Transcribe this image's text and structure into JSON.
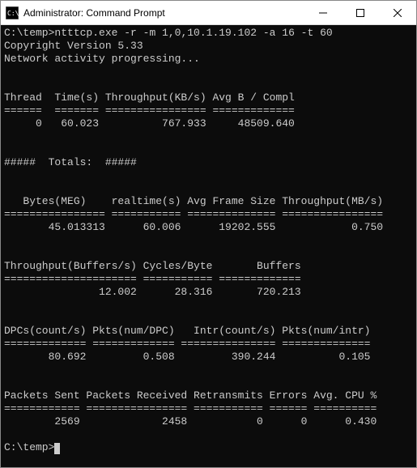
{
  "titlebar": {
    "title": "Administrator: Command Prompt"
  },
  "terminal": {
    "prompt1": "C:\\temp>",
    "command": "ntttcp.exe -r -m 1,0,10.1.19.102 -a 16 -t 60",
    "line_copyright": "Copyright Version 5.33",
    "line_activity": "Network activity progressing...",
    "sec1_header": "Thread  Time(s) Throughput(KB/s) Avg B / Compl",
    "sec1_sep": "======  ======= ================ =============",
    "sec1_row": "     0   60.023          767.933     48509.640",
    "totals_label": "#####  Totals:  #####",
    "sec2_header": "   Bytes(MEG)    realtime(s) Avg Frame Size Throughput(MB/s)",
    "sec2_sep": "================ =========== ============== ================",
    "sec2_row": "       45.013313      60.006      19202.555            0.750",
    "sec3_header": "Throughput(Buffers/s) Cycles/Byte       Buffers",
    "sec3_sep": "===================== =========== =============",
    "sec3_row": "               12.002      28.316       720.213",
    "sec4_header": "DPCs(count/s) Pkts(num/DPC)   Intr(count/s) Pkts(num/intr)",
    "sec4_sep": "============= ============= =============== ==============",
    "sec4_row": "       80.692         0.508         390.244          0.105",
    "sec5_header": "Packets Sent Packets Received Retransmits Errors Avg. CPU %",
    "sec5_sep": "============ ================ =========== ====== ==========",
    "sec5_row": "        2569             2458           0      0      0.430",
    "prompt2": "C:\\temp>"
  }
}
